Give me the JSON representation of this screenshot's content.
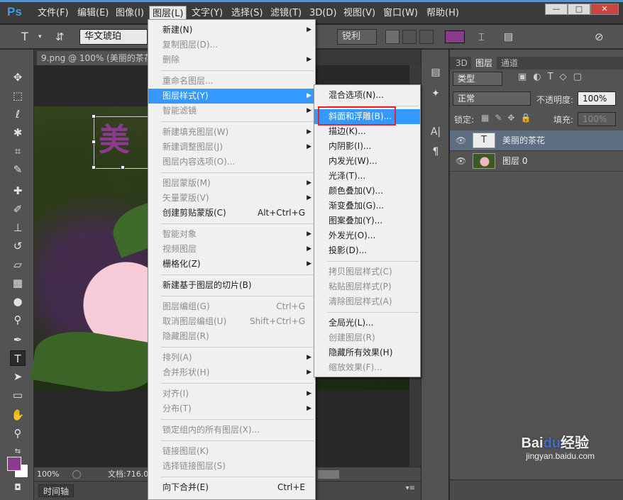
{
  "app": {
    "logo": "Ps"
  },
  "menubar": {
    "items": [
      "文件(F)",
      "编辑(E)",
      "图像(I)",
      "图层(L)",
      "文字(Y)",
      "选择(S)",
      "滤镜(T)",
      "3D(D)",
      "视图(V)",
      "窗口(W)",
      "帮助(H)"
    ],
    "active": "图层(L)"
  },
  "window_controls": {
    "minimize": "—",
    "restore": "□",
    "close": "✕"
  },
  "options_bar": {
    "font_family": "华文琥珀",
    "aa_method": "锐利",
    "text_color": "#8a3b8e"
  },
  "document": {
    "tab_title": "9.png @ 100% (美丽的茶花",
    "text_preview": "美",
    "zoom": "100%",
    "doc_info": "文档:716.0"
  },
  "timeline": {
    "label": "时间轴"
  },
  "layers_panel": {
    "tabs": [
      "3D",
      "图层",
      "通道"
    ],
    "active_tab": "图层",
    "filter_kind": "类型",
    "blend_mode": "正常",
    "opacity_label": "不透明度:",
    "opacity_value": "100%",
    "lock_label": "锁定:",
    "fill_label": "填充:",
    "fill_value": "100%",
    "layers": [
      {
        "name": "美丽的茶花",
        "thumb": "T",
        "selected": true
      },
      {
        "name": "图层 0",
        "thumb": "",
        "selected": false
      }
    ]
  },
  "layer_menu": [
    {
      "label": "新建(N)",
      "arrow": true
    },
    {
      "label": "复制图层(D)...",
      "disabled": true
    },
    {
      "label": "删除",
      "arrow": true,
      "disabled": true
    },
    {
      "sep": true
    },
    {
      "label": "重命名图层...",
      "disabled": true
    },
    {
      "label": "图层样式(Y)",
      "arrow": true,
      "highlight": true
    },
    {
      "label": "智能滤镜",
      "arrow": true,
      "disabled": true
    },
    {
      "sep": true
    },
    {
      "label": "新建填充图层(W)",
      "arrow": true,
      "disabled": true
    },
    {
      "label": "新建调整图层(J)",
      "arrow": true,
      "disabled": true
    },
    {
      "label": "图层内容选项(O)...",
      "disabled": true
    },
    {
      "sep": true
    },
    {
      "label": "图层蒙版(M)",
      "arrow": true,
      "disabled": true
    },
    {
      "label": "矢量蒙版(V)",
      "arrow": true,
      "disabled": true
    },
    {
      "label": "创建剪贴蒙版(C)",
      "shortcut": "Alt+Ctrl+G"
    },
    {
      "sep": true
    },
    {
      "label": "智能对象",
      "arrow": true,
      "disabled": true
    },
    {
      "label": "视频图层",
      "arrow": true,
      "disabled": true
    },
    {
      "label": "栅格化(Z)",
      "arrow": true
    },
    {
      "sep": true
    },
    {
      "label": "新建基于图层的切片(B)"
    },
    {
      "sep": true
    },
    {
      "label": "图层编组(G)",
      "shortcut": "Ctrl+G",
      "disabled": true
    },
    {
      "label": "取消图层编组(U)",
      "shortcut": "Shift+Ctrl+G",
      "disabled": true
    },
    {
      "label": "隐藏图层(R)",
      "disabled": true
    },
    {
      "sep": true
    },
    {
      "label": "排列(A)",
      "arrow": true,
      "disabled": true
    },
    {
      "label": "合并形状(H)",
      "arrow": true,
      "disabled": true
    },
    {
      "sep": true
    },
    {
      "label": "对齐(I)",
      "arrow": true,
      "disabled": true
    },
    {
      "label": "分布(T)",
      "arrow": true,
      "disabled": true
    },
    {
      "sep": true
    },
    {
      "label": "锁定组内的所有图层(X)...",
      "disabled": true
    },
    {
      "sep": true
    },
    {
      "label": "链接图层(K)",
      "disabled": true
    },
    {
      "label": "选择链接图层(S)",
      "disabled": true
    },
    {
      "sep": true
    },
    {
      "label": "向下合并(E)",
      "shortcut": "Ctrl+E"
    }
  ],
  "style_submenu": [
    {
      "label": "混合选项(N)..."
    },
    {
      "sep": true
    },
    {
      "label": "斜面和浮雕(B)...",
      "highlight": true
    },
    {
      "label": "描边(K)..."
    },
    {
      "label": "内阴影(I)..."
    },
    {
      "label": "内发光(W)..."
    },
    {
      "label": "光泽(T)..."
    },
    {
      "label": "颜色叠加(V)..."
    },
    {
      "label": "渐变叠加(G)..."
    },
    {
      "label": "图案叠加(Y)..."
    },
    {
      "label": "外发光(O)..."
    },
    {
      "label": "投影(D)..."
    },
    {
      "sep": true
    },
    {
      "label": "拷贝图层样式(C)",
      "disabled": true
    },
    {
      "label": "粘贴图层样式(P)",
      "disabled": true
    },
    {
      "label": "清除图层样式(A)",
      "disabled": true
    },
    {
      "sep": true
    },
    {
      "label": "全局光(L)..."
    },
    {
      "label": "创建图层(R)",
      "disabled": true
    },
    {
      "label": "隐藏所有效果(H)"
    },
    {
      "label": "缩放效果(F)...",
      "disabled": true
    }
  ],
  "watermark": {
    "brand": "Bai",
    "logo": "du",
    "suffix": "经验",
    "url": "jingyan.baidu.com"
  }
}
